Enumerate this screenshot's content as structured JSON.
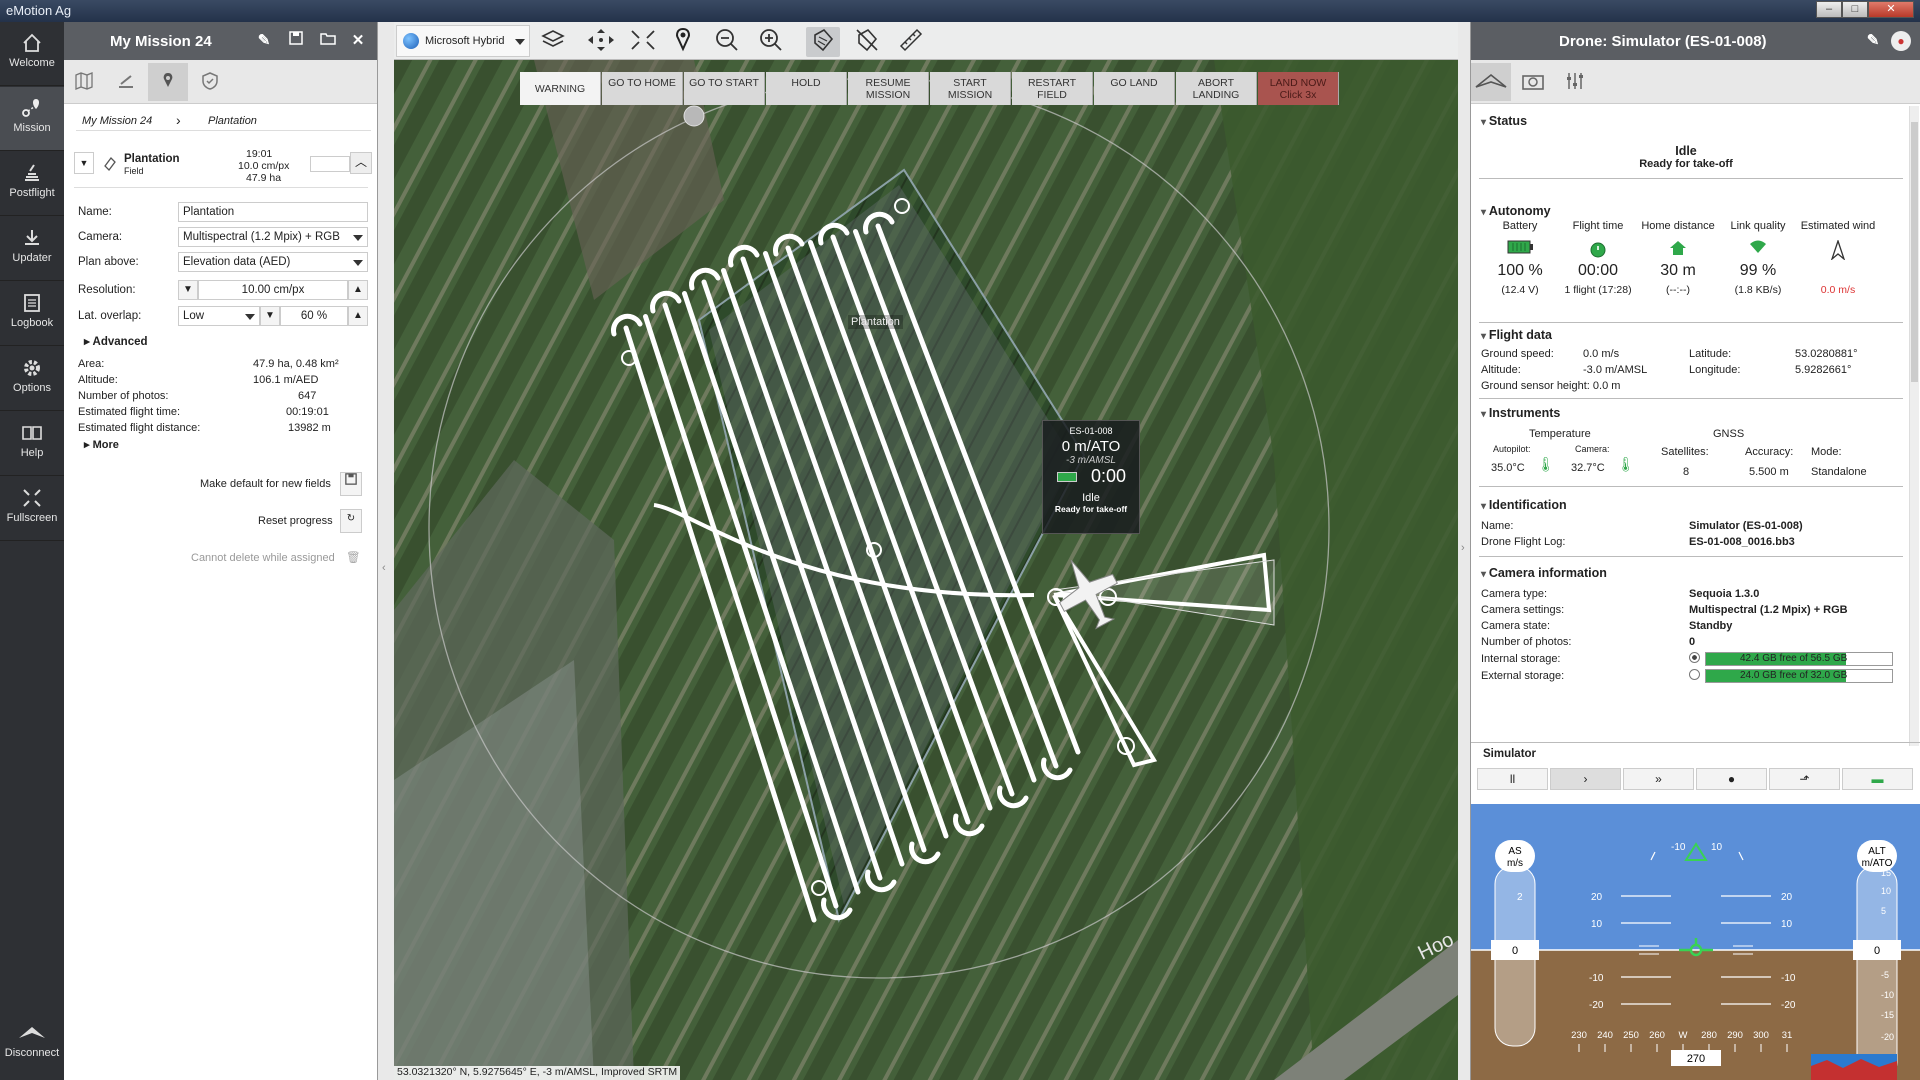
{
  "window": {
    "title": "eMotion Ag"
  },
  "nav": [
    {
      "label": "Welcome",
      "icon": "home-icon"
    },
    {
      "label": "Mission",
      "icon": "mission-icon"
    },
    {
      "label": "Postflight",
      "icon": "postflight-icon"
    },
    {
      "label": "Updater",
      "icon": "download-icon"
    },
    {
      "label": "Logbook",
      "icon": "logbook-icon"
    },
    {
      "label": "Options",
      "icon": "gear-icon"
    },
    {
      "label": "Help",
      "icon": "book-icon"
    },
    {
      "label": "Fullscreen",
      "icon": "fullscreen-icon"
    },
    {
      "label": "Disconnect",
      "icon": "disconnect-icon"
    }
  ],
  "mission": {
    "title": "My Mission 24",
    "breadcrumb": [
      "My Mission 24",
      "Plantation"
    ],
    "block": {
      "name": "Plantation",
      "type": "Field",
      "time": "19:01",
      "resolution": "10.0 cm/px",
      "area": "47.9 ha"
    },
    "fields": {
      "name_label": "Name:",
      "name_value": "Plantation",
      "camera_label": "Camera:",
      "camera_value": "Multispectral (1.2 Mpix) + RGB",
      "plan_label": "Plan above:",
      "plan_value": "Elevation data (AED)",
      "resolution_label": "Resolution:",
      "resolution_value": "10.00 cm/px",
      "overlap_label": "Lat. overlap:",
      "overlap_level": "Low",
      "overlap_value": "60 %"
    },
    "advanced_label": "Advanced",
    "stats": [
      {
        "k": "Area:",
        "v": "47.9 ha, 0.48 km²"
      },
      {
        "k": "Altitude:",
        "v": "106.1 m/AED"
      },
      {
        "k": "Number of photos:",
        "v": "647"
      },
      {
        "k": "Estimated flight time:",
        "v": "00:19:01"
      },
      {
        "k": "Estimated flight distance:",
        "v": "13982 m"
      }
    ],
    "more_label": "More",
    "make_default": "Make default for new fields",
    "reset_progress": "Reset progress",
    "cannot_delete": "Cannot delete while assigned"
  },
  "map": {
    "basemap": "Microsoft Hybrid",
    "commands": [
      {
        "label": "WARNING",
        "kind": "warn"
      },
      {
        "label": "GO TO HOME",
        "kind": "normal"
      },
      {
        "label": "GO TO START",
        "kind": "normal"
      },
      {
        "label": "HOLD",
        "kind": "normal"
      },
      {
        "label": "RESUME MISSION",
        "kind": "normal"
      },
      {
        "label": "START MISSION",
        "kind": "normal"
      },
      {
        "label": "RESTART FIELD",
        "kind": "normal"
      },
      {
        "label": "GO LAND",
        "kind": "normal"
      },
      {
        "label": "ABORT LANDING",
        "kind": "normal"
      },
      {
        "label": "LAND NOW Click 3x",
        "kind": "land"
      }
    ],
    "field_label": "Plantation",
    "road_label": "Hoo",
    "drone_tag": {
      "id": "ES-01-008",
      "altitude": "0 m/ATO",
      "amsl": "-3 m/AMSL",
      "time": "0:00",
      "status": "Idle",
      "substatus": "Ready for take-off"
    },
    "status_bar": "53.0321320° N, 5.9275645° E, -3 m/AMSL, Improved SRTM"
  },
  "drone": {
    "title": "Drone: Simulator (ES-01-008)",
    "status": {
      "header": "Status",
      "state": "Idle",
      "detail": "Ready for take-off"
    },
    "autonomy": {
      "header": "Autonomy",
      "items": [
        {
          "label": "Battery",
          "value": "100 %",
          "sub": "(12.4 V)",
          "icon": "battery-icon"
        },
        {
          "label": "Flight time",
          "value": "00:00",
          "sub": "1 flight (17:28)",
          "icon": "stopwatch-icon"
        },
        {
          "label": "Home distance",
          "value": "30 m",
          "sub": "(--:--)",
          "icon": "home-icon"
        },
        {
          "label": "Link quality",
          "value": "99 %",
          "sub": "(1.8 KB/s)",
          "icon": "wifi-icon"
        },
        {
          "label": "Estimated wind",
          "value": "",
          "sub": "0.0 m/s",
          "icon": "wind-arrow-icon"
        }
      ]
    },
    "flight_data": {
      "header": "Flight data",
      "ground_speed_label": "Ground speed:",
      "ground_speed": "0.0 m/s",
      "altitude_label": "Altitude:",
      "altitude": "-3.0 m/AMSL",
      "latitude_label": "Latitude:",
      "latitude": "53.0280881°",
      "longitude_label": "Longitude:",
      "longitude": "5.9282661°",
      "sensor_height": "Ground sensor height: 0.0 m"
    },
    "instruments": {
      "header": "Instruments",
      "temperature_label": "Temperature",
      "autopilot_label": "Autopilot:",
      "autopilot_temp": "35.0°C",
      "camera_label": "Camera:",
      "camera_temp": "32.7°C",
      "gnss_label": "GNSS",
      "satellites_label": "Satellites:",
      "satellites": "8",
      "accuracy_label": "Accuracy:",
      "accuracy": "5.500 m",
      "mode_label": "Mode:",
      "mode": "Standalone"
    },
    "identification": {
      "header": "Identification",
      "name_label": "Name:",
      "name": "Simulator (ES-01-008)",
      "log_label": "Drone Flight Log:",
      "log": "ES-01-008_0016.bb3"
    },
    "camera": {
      "header": "Camera information",
      "type_label": "Camera type:",
      "type": "Sequoia 1.3.0",
      "settings_label": "Camera settings:",
      "settings": "Multispectral (1.2 Mpix) + RGB",
      "state_label": "Camera state:",
      "state": "Standby",
      "photos_label": "Number of photos:",
      "photos": "0",
      "internal_label": "Internal storage:",
      "internal": "42.4 GB free of 56.5 GB",
      "internal_free_fraction": 0.75,
      "external_label": "External storage:",
      "external": "24.0 GB free of 32.0 GB",
      "external_free_fraction": 0.75
    },
    "simulator": {
      "label": "Simulator",
      "buttons": [
        "pause-icon",
        "play-icon",
        "fast-forward-icon",
        "location-icon",
        "launch-icon",
        "battery-icon"
      ]
    },
    "pfd": {
      "as_label": "AS",
      "as_unit": "m/s",
      "as_value": "0",
      "as_tick": "2",
      "alt_label": "ALT",
      "alt_unit": "m/ATO",
      "alt_value": "0",
      "alt_ticks": [
        "15",
        "10",
        "5",
        "-5",
        "-10",
        "-15",
        "-20"
      ],
      "roll_left": "-10",
      "roll_right": "10",
      "pitch_up": [
        "20",
        "10"
      ],
      "pitch_down": [
        "-10",
        "-20"
      ],
      "heading_ticks": [
        "230",
        "240",
        "250",
        "260",
        "W",
        "280",
        "290",
        "300",
        "31"
      ],
      "heading": "270"
    }
  },
  "colors": {
    "sky": "#5b8fd8",
    "ground": "#8d6a45",
    "green_fill": "#2fa84a",
    "header": "#5b5e63",
    "land_now": "#a9544f"
  }
}
